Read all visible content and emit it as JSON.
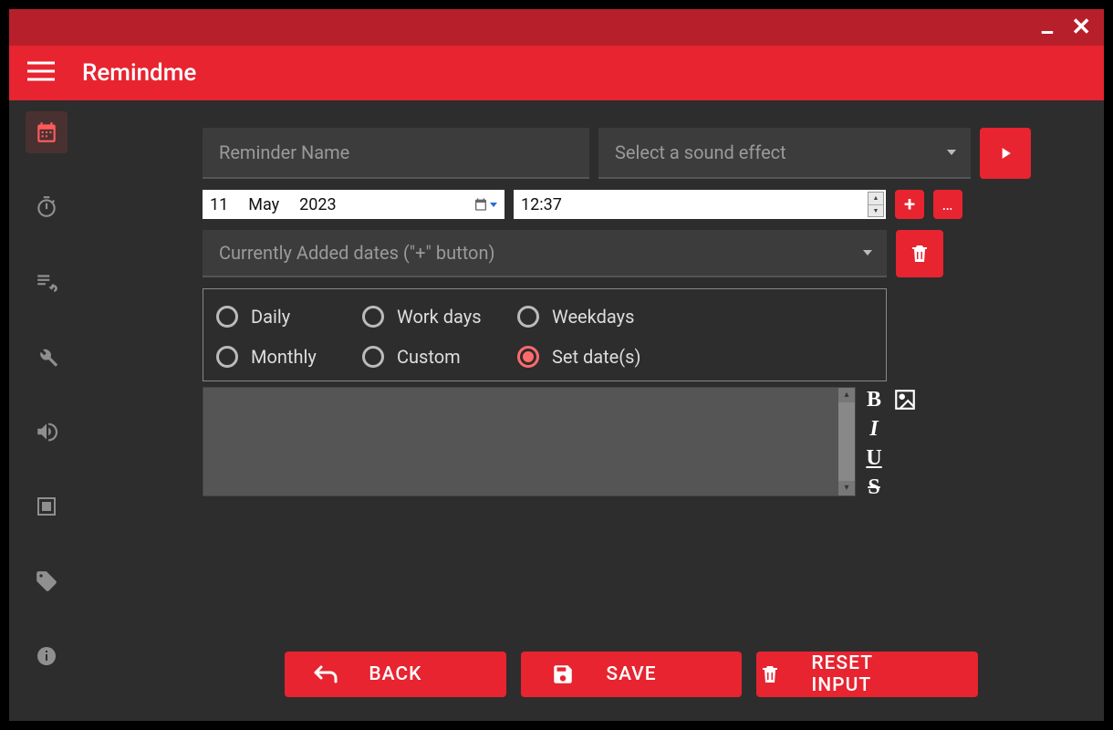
{
  "app": {
    "title": "Remindme"
  },
  "window_controls": {
    "minimize": "−",
    "close": "×"
  },
  "sidebar": {
    "items": [
      {
        "name": "calendar",
        "active": true
      },
      {
        "name": "stopwatch",
        "active": false
      },
      {
        "name": "list-loop",
        "active": false
      },
      {
        "name": "settings-wrench",
        "active": false
      },
      {
        "name": "audio",
        "active": false
      },
      {
        "name": "resize-frame",
        "active": false
      },
      {
        "name": "tags",
        "active": false
      },
      {
        "name": "info",
        "active": false
      }
    ]
  },
  "form": {
    "name_placeholder": "Reminder Name",
    "sound_placeholder": "Select a sound effect",
    "date": {
      "day": "11",
      "month": "May",
      "year": "2023"
    },
    "time": "12:37",
    "added_dates_label": "Currently Added dates (\"+\" button)",
    "recurrence": {
      "options": [
        {
          "id": "daily",
          "label": "Daily",
          "selected": false
        },
        {
          "id": "workdays",
          "label": "Work days",
          "selected": false
        },
        {
          "id": "weekdays",
          "label": "Weekdays",
          "selected": false
        },
        {
          "id": "monthly",
          "label": "Monthly",
          "selected": false
        },
        {
          "id": "custom",
          "label": "Custom",
          "selected": false
        },
        {
          "id": "setdates",
          "label": "Set date(s)",
          "selected": true
        }
      ]
    }
  },
  "format_buttons": {
    "bold": "B",
    "italic": "I",
    "underline": "U",
    "strike": "S"
  },
  "actions": {
    "back": "BACK",
    "save": "SAVE",
    "reset": "RESET INPUT"
  }
}
